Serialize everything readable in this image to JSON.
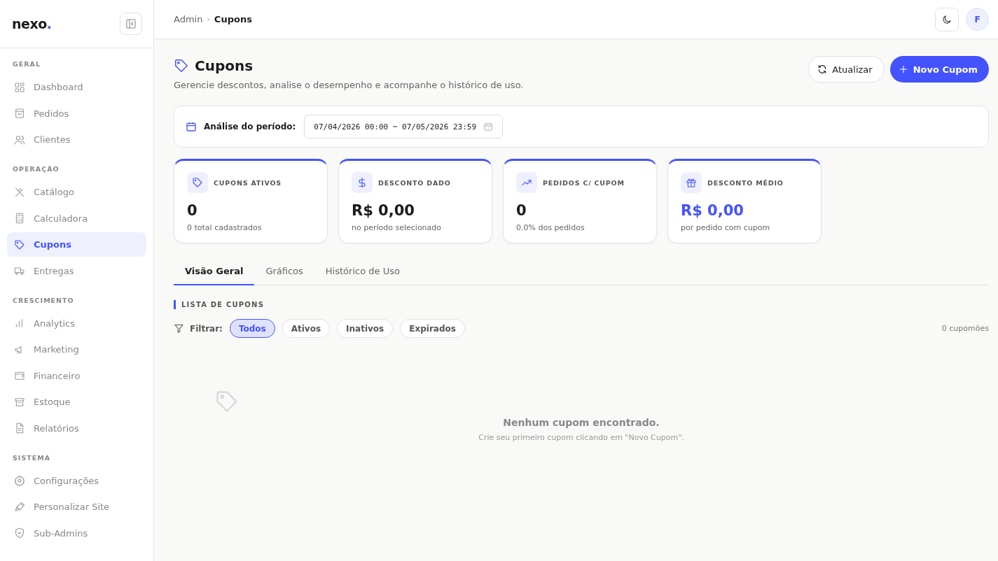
{
  "brand": {
    "name": "nexo",
    "dot": "."
  },
  "sidebar": {
    "sections": [
      {
        "title": "GERAL",
        "items": [
          {
            "label": "Dashboard",
            "selected": false
          },
          {
            "label": "Pedidos",
            "selected": false
          },
          {
            "label": "Clientes",
            "selected": false
          }
        ]
      },
      {
        "title": "OPERAÇÃO",
        "items": [
          {
            "label": "Catálogo",
            "selected": false
          },
          {
            "label": "Calculadora",
            "selected": false
          },
          {
            "label": "Cupons",
            "selected": true
          },
          {
            "label": "Entregas",
            "selected": false
          }
        ]
      },
      {
        "title": "CRESCIMENTO",
        "items": [
          {
            "label": "Analytics",
            "selected": false
          },
          {
            "label": "Marketing",
            "selected": false
          },
          {
            "label": "Financeiro",
            "selected": false
          },
          {
            "label": "Estoque",
            "selected": false
          },
          {
            "label": "Relatórios",
            "selected": false
          }
        ]
      },
      {
        "title": "SISTEMA",
        "items": [
          {
            "label": "Configurações",
            "selected": false
          },
          {
            "label": "Personalizar Site",
            "selected": false
          },
          {
            "label": "Sub-Admins",
            "selected": false
          }
        ]
      }
    ]
  },
  "breadcrumb": [
    "Admin",
    "Cupons"
  ],
  "breadcrumb_separator": "›",
  "avatar": "F",
  "page": {
    "title": "Cupons",
    "subtitle": "Gerencie descontos, analise o desempenho e acompanhe o histórico de uso.",
    "buttons": [
      {
        "label": "Atualizar",
        "kind": "refresh"
      },
      {
        "label": "Novo Cupom",
        "kind": "primary"
      }
    ]
  },
  "period": {
    "label": "Análise do período:",
    "value": "07/04/2026 00:00 ~ 07/05/2026 23:59"
  },
  "stats": [
    {
      "title": "CUPONS ATIVOS",
      "value": "0",
      "note": "0 total cadastrados",
      "highlighted": false
    },
    {
      "title": "DESCONTO DADO",
      "value": "R$ 0,00",
      "note": "no período selecionado",
      "highlighted": false
    },
    {
      "title": "PEDIDOS C/ CUPOM",
      "value": "0",
      "note": "0.0% dos pedidos",
      "highlighted": false
    },
    {
      "title": "DESCONTO MÉDIO",
      "value": "R$ 0,00",
      "note": "por pedido com cupom",
      "highlighted": true
    }
  ],
  "tabs": [
    {
      "label": "Visão Geral",
      "selected": true
    },
    {
      "label": "Gráficos",
      "selected": false
    },
    {
      "label": "Histórico de Uso",
      "selected": false
    }
  ],
  "list": {
    "title": "LISTA DE CUPONS",
    "filter_label": "Filtrar:",
    "filters": [
      {
        "label": "Todos",
        "selected": true
      },
      {
        "label": "Ativos",
        "selected": false
      },
      {
        "label": "Inativos",
        "selected": false
      },
      {
        "label": "Expirados",
        "selected": false
      }
    ],
    "count": "0 cupomões"
  },
  "empty": {
    "title": "Nenhum cupom encontrado.",
    "hint": "Crie seu primeiro cupom clicando em \"Novo Cupom\"."
  }
}
